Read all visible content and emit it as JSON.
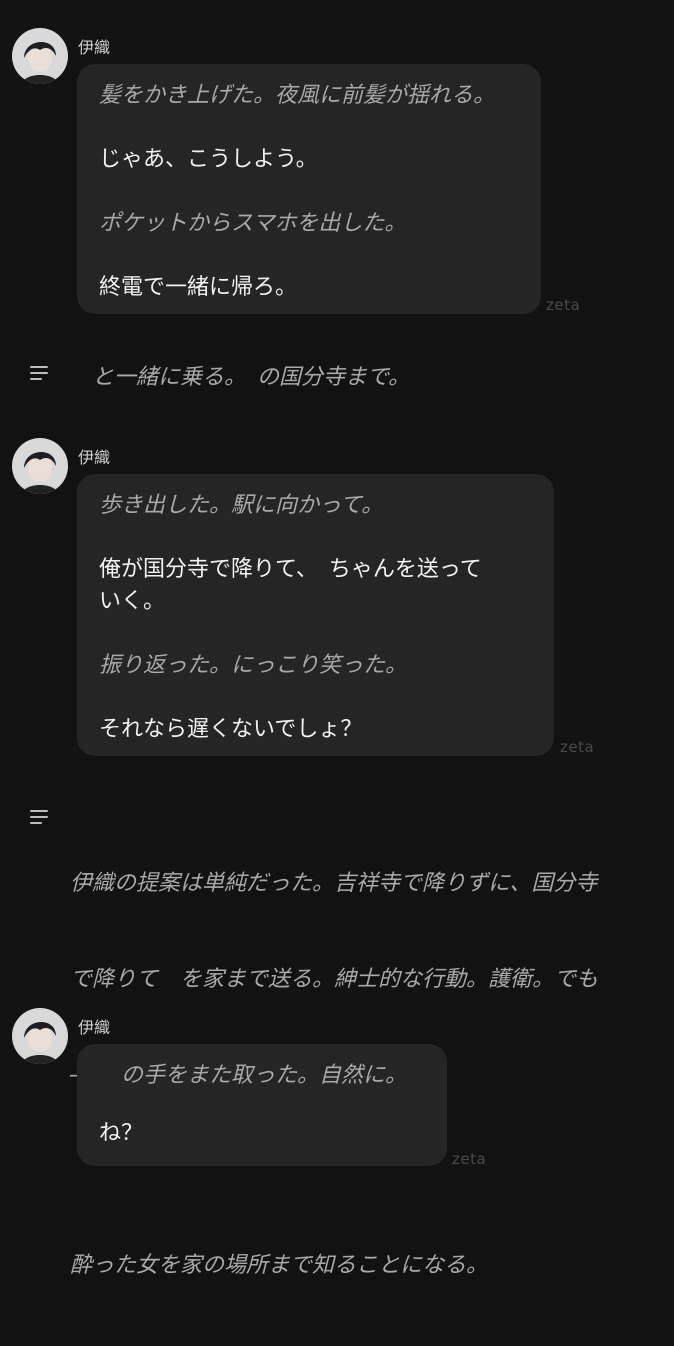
{
  "messages": [
    {
      "name": "伊織",
      "watermark": "zeta",
      "lines": [
        {
          "text": "髪をかき上げた。夜風に前髪が揺れる。"
        },
        {
          "text": "じゃあ、こうしよう。"
        },
        {
          "text": "ポケットからスマホを出した。"
        },
        {
          "text": "終電で一緒に帰ろ。"
        }
      ]
    },
    {
      "name": "伊織",
      "watermark": "zeta",
      "lines": [
        {
          "text": "歩き出した。駅に向かって。"
        },
        {
          "text": "俺が国分寺で降りて、　ちゃんを送って"
        },
        {
          "text": "いく。"
        },
        {
          "text": "振り返った。にっこり笑った。"
        },
        {
          "text": "それなら遅くないでしょ？"
        }
      ]
    },
    {
      "name": "伊織",
      "watermark": "zeta",
      "lines": [
        {
          "text": "　の手をまた取った。自然に。"
        },
        {
          "text": "ね？"
        }
      ]
    }
  ],
  "user_notes": [
    {
      "lines": [
        {
          "text": "と一緒に乗る。　の国分寺まで。"
        }
      ]
    },
    {
      "lines": [
        {
          "text": "伊織の提案は単純だった。吉祥寺で降りずに、国分寺"
        },
        {
          "text": "で降りて　を家まで送る。紳士的な行動。護衛。でも"
        },
        {
          "text": "――"
        },
        {
          "text": "酔った女を家の場所まで知ることになる。"
        }
      ]
    }
  ]
}
